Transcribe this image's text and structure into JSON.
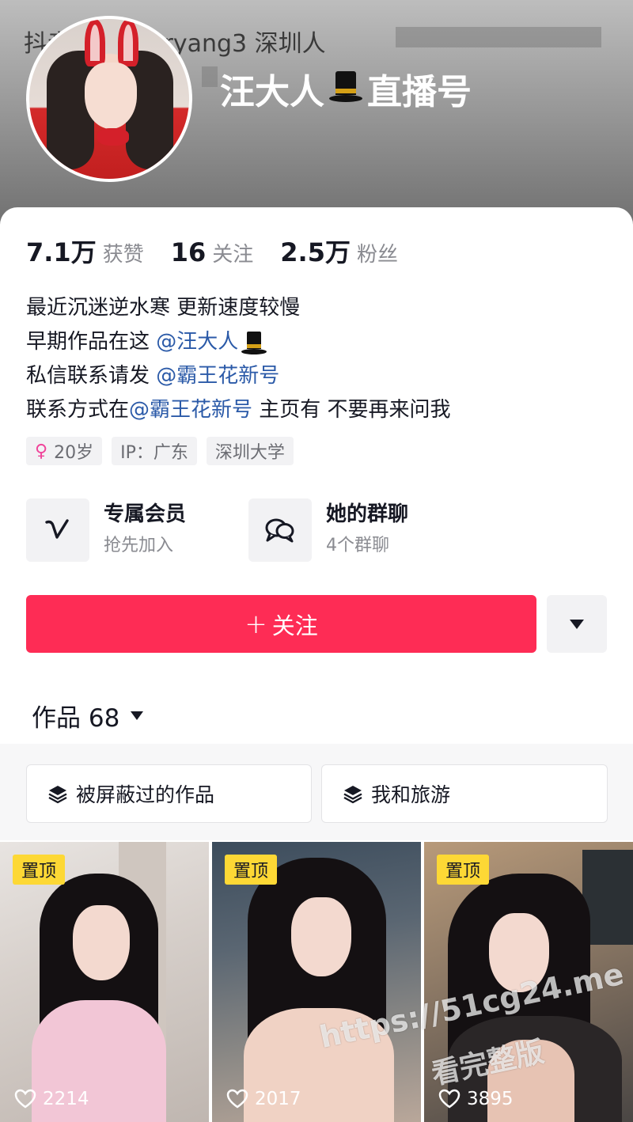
{
  "header": {
    "id_line": "抖音号：ugeryang3 深圳人",
    "display_name": "汪大人",
    "display_name_suffix": "直播号"
  },
  "stats": [
    {
      "value": "7.1万",
      "label": "获赞"
    },
    {
      "value": "16",
      "label": "关注"
    },
    {
      "value": "2.5万",
      "label": "粉丝"
    }
  ],
  "bio": {
    "line1": "最近沉迷逆水寒 更新速度较慢",
    "line2_prefix": "早期作品在这 ",
    "line2_mention": "@汪大人",
    "line3_prefix": "私信联系请发 ",
    "line3_mention": "@霸王花新号",
    "line4_prefix": "联系方式在",
    "line4_mention": "@霸王花新号",
    "line4_suffix": " 主页有 不要再来问我"
  },
  "tags": {
    "age": "20岁",
    "ip": "IP：广东",
    "school": "深圳大学"
  },
  "features": {
    "member": {
      "title": "专属会员",
      "subtitle": "抢先加入"
    },
    "group": {
      "title": "她的群聊",
      "subtitle": "4个群聊"
    }
  },
  "actions": {
    "follow_label": "关注"
  },
  "works": {
    "label": "作品 68"
  },
  "collections": [
    {
      "label": "被屏蔽过的作品"
    },
    {
      "label": "我和旅游"
    }
  ],
  "videos": [
    {
      "pinned_label": "置顶",
      "likes": "2214"
    },
    {
      "pinned_label": "置顶",
      "likes": "2017"
    },
    {
      "pinned_label": "置顶",
      "likes": "3895"
    }
  ],
  "watermark": {
    "url": "https://51cg24.me",
    "text": "看完整版"
  },
  "colors": {
    "accent": "#fe2c55",
    "mention": "#2b5aa8",
    "pin_badge": "#fdd835"
  }
}
